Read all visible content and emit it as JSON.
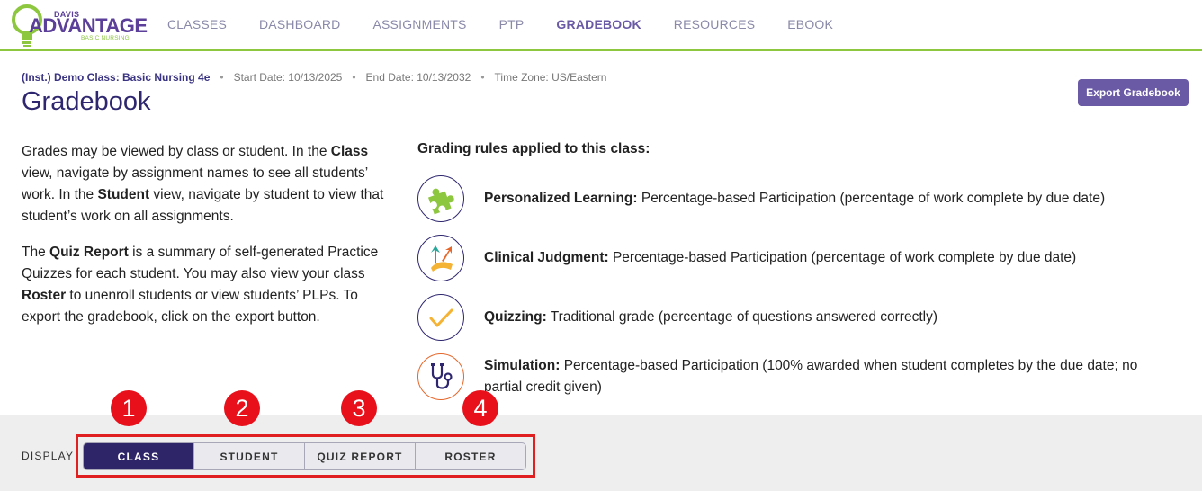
{
  "brand": {
    "small": "DAVIS",
    "name": "ADVANTAGE",
    "sub": "BASIC NURSING",
    "green": "#8dc63f",
    "purple": "#5b3f99"
  },
  "nav": [
    {
      "label": "CLASSES"
    },
    {
      "label": "DASHBOARD"
    },
    {
      "label": "ASSIGNMENTS"
    },
    {
      "label": "PTP"
    },
    {
      "label": "GRADEBOOK",
      "active": true
    },
    {
      "label": "RESOURCES"
    },
    {
      "label": "EBOOK"
    }
  ],
  "header": {
    "class_name": "(Inst.) Demo Class: Basic Nursing 4e",
    "start_date": "Start Date: 10/13/2025",
    "end_date": "End Date: 10/13/2032",
    "time_zone": "Time Zone: US/Eastern",
    "separator": "•",
    "title": "Gradebook",
    "export_label": "Export Gradebook"
  },
  "intro": {
    "p1": [
      {
        "t": "Grades may be viewed by class or student. In the "
      },
      {
        "t": "Class",
        "b": true
      },
      {
        "t": " view, navigate by assignment names to see all students’ work. In the "
      },
      {
        "t": "Student",
        "b": true
      },
      {
        "t": " view, navigate by student to view that student’s work on all assignments."
      }
    ],
    "p2": [
      {
        "t": "The "
      },
      {
        "t": "Quiz Report",
        "b": true
      },
      {
        "t": " is a summary of self-generated Practice Quizzes for each student. You may also view your class "
      },
      {
        "t": "Roster",
        "b": true
      },
      {
        "t": " to unenroll students or view students’ PLPs. To export the gradebook, click on the export button."
      }
    ]
  },
  "rules": {
    "title": "Grading rules applied to this class:",
    "items": [
      {
        "icon": "puzzle-icon",
        "name": "Personalized Learning:",
        "desc": "Percentage-based Participation (percentage of work complete by due date)"
      },
      {
        "icon": "clinical-judgment-icon",
        "name": "Clinical Judgment:",
        "desc": "Percentage-based Participation (percentage of work complete by due date)"
      },
      {
        "icon": "checkmark-icon",
        "name": "Quizzing:",
        "desc": "Traditional grade (percentage of questions answered correctly)"
      },
      {
        "icon": "stethoscope-icon",
        "name": "Simulation:",
        "desc": "Percentage-based Participation (100% awarded when student completes by the due date; no partial credit given)"
      }
    ]
  },
  "display": {
    "label": "DISPLAY",
    "options": [
      "CLASS",
      "STUDENT",
      "QUIZ REPORT",
      "ROSTER"
    ],
    "selected": "CLASS",
    "callouts": [
      "1",
      "2",
      "3",
      "4"
    ]
  }
}
